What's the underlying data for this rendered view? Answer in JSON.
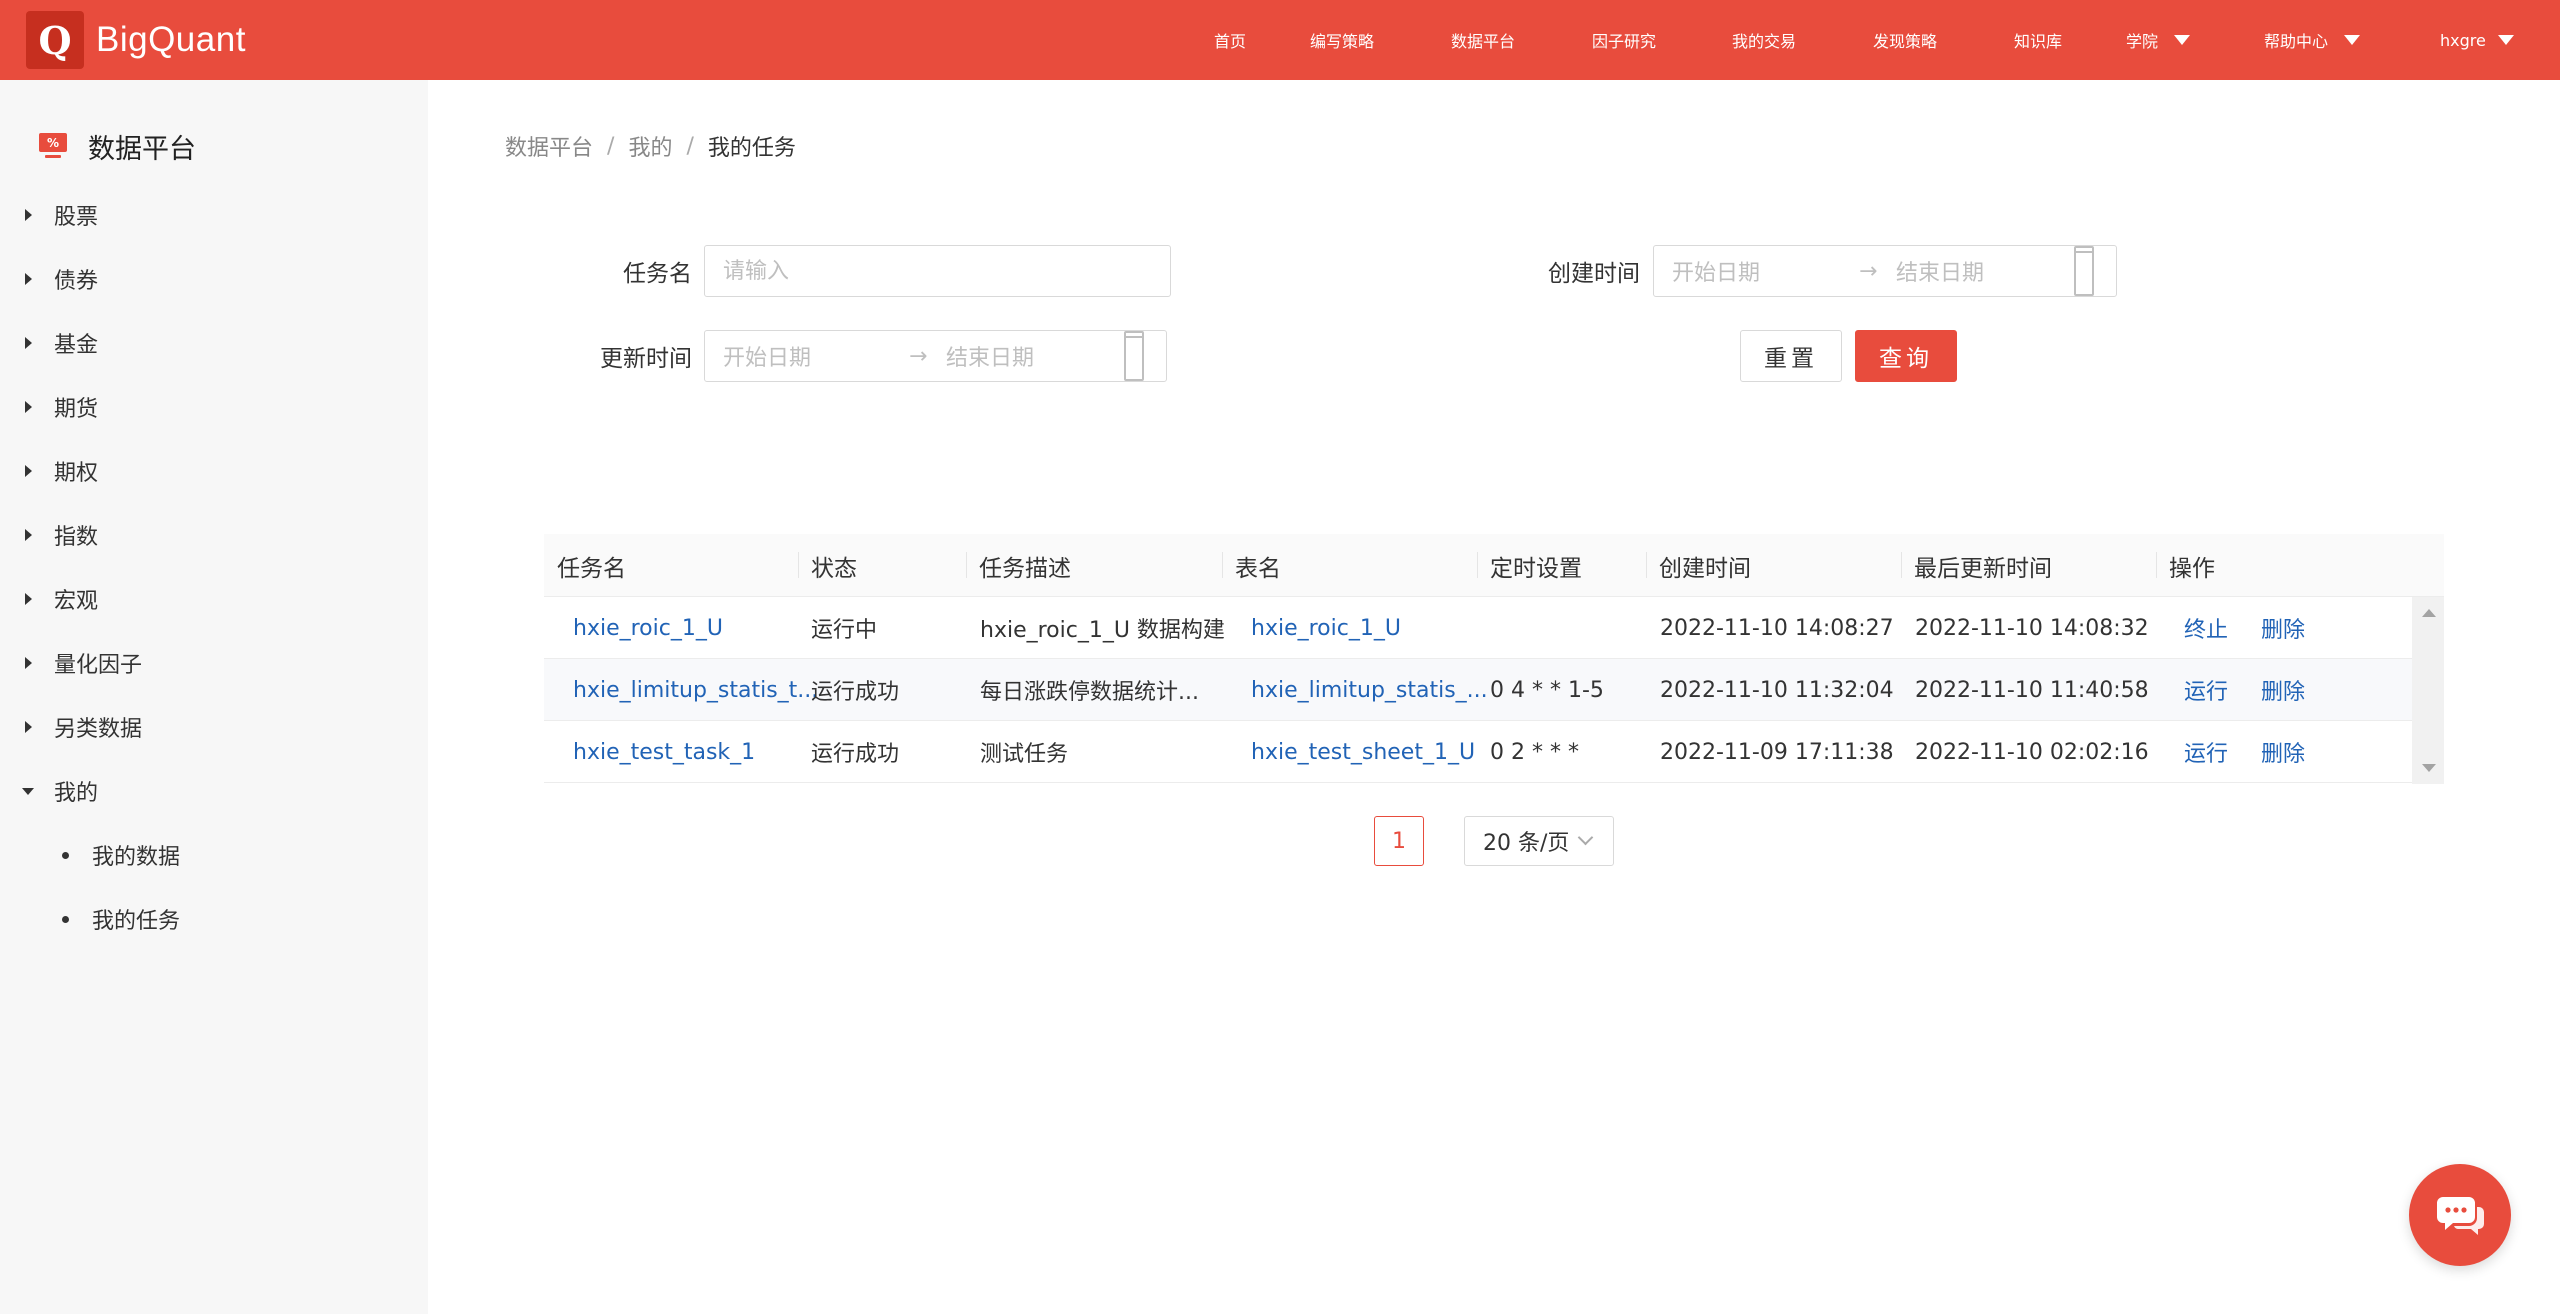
{
  "brand": {
    "logo_letter": "Q",
    "name": "BigQuant"
  },
  "nav": [
    {
      "label": "首页"
    },
    {
      "label": "编写策略"
    },
    {
      "label": "数据平台"
    },
    {
      "label": "因子研究"
    },
    {
      "label": "我的交易"
    },
    {
      "label": "发现策略"
    },
    {
      "label": "知识库"
    },
    {
      "label": "学院"
    },
    {
      "label": "帮助中心"
    },
    {
      "label": "hxgre"
    }
  ],
  "sidebar": {
    "title": "数据平台",
    "items": [
      {
        "label": "股票"
      },
      {
        "label": "债券"
      },
      {
        "label": "基金"
      },
      {
        "label": "期货"
      },
      {
        "label": "期权"
      },
      {
        "label": "指数"
      },
      {
        "label": "宏观"
      },
      {
        "label": "量化因子"
      },
      {
        "label": "另类数据"
      },
      {
        "label": "我的"
      }
    ],
    "sub_items": [
      {
        "label": "我的数据"
      },
      {
        "label": "我的任务"
      }
    ]
  },
  "breadcrumb": [
    "数据平台",
    "我的",
    "我的任务"
  ],
  "breadcrumb_sep": "/",
  "filters": {
    "task_name_label": "任务名",
    "task_name_placeholder": "请输入",
    "created_label": "创建时间",
    "updated_label": "更新时间",
    "start_placeholder": "开始日期",
    "end_placeholder": "结束日期",
    "range_arrow": "→",
    "reset_label": "重置",
    "query_label": "查询"
  },
  "table": {
    "columns": [
      "任务名",
      "状态",
      "任务描述",
      "表名",
      "定时设置",
      "创建时间",
      "最后更新时间",
      "操作"
    ],
    "rows": [
      {
        "name": "hxie_roic_1_U",
        "status": "运行中",
        "desc": "hxie_roic_1_U 数据构建",
        "table": "hxie_roic_1_U",
        "schedule": "",
        "created": "2022-11-10 14:08:27",
        "updated": "2022-11-10 14:08:32",
        "action1": "终止",
        "action2": "删除"
      },
      {
        "name": "hxie_limitup_statis_t...",
        "status": "运行成功",
        "desc": "每日涨跌停数据统计...",
        "table": "hxie_limitup_statis_...",
        "schedule": "0 4 * * 1-5",
        "created": "2022-11-10 11:32:04",
        "updated": "2022-11-10 11:40:58",
        "action1": "运行",
        "action2": "删除"
      },
      {
        "name": "hxie_test_task_1",
        "status": "运行成功",
        "desc": "测试任务",
        "table": "hxie_test_sheet_1_U",
        "schedule": "0 2 * * *",
        "created": "2022-11-09 17:11:38",
        "updated": "2022-11-10 02:02:16",
        "action1": "运行",
        "action2": "删除"
      }
    ]
  },
  "pagination": {
    "current_page": "1",
    "page_size": "20 条/页"
  },
  "colors": {
    "brand": "#e84c3d",
    "link": "#2163b6"
  }
}
